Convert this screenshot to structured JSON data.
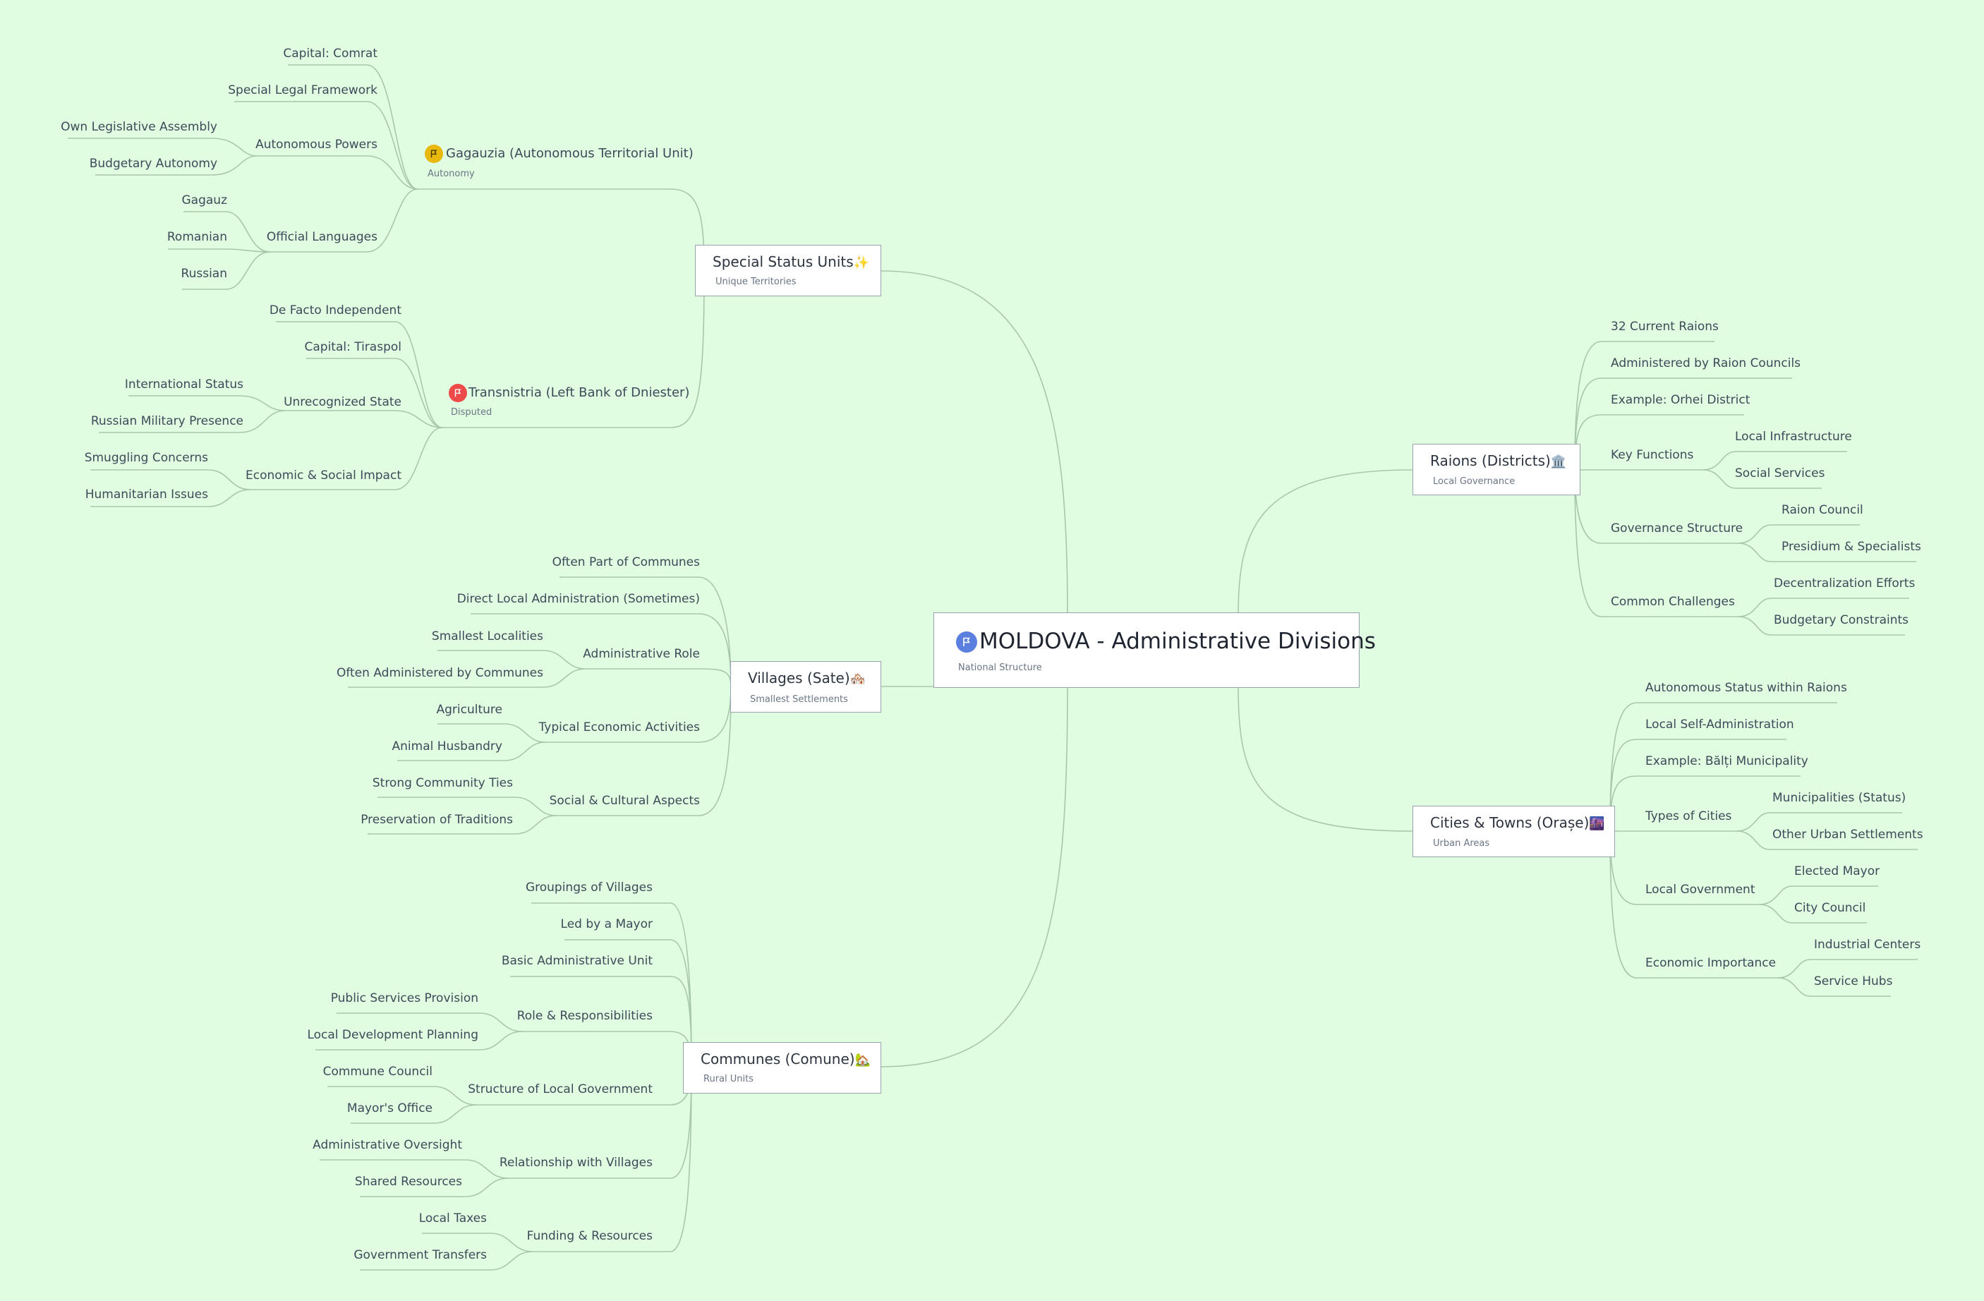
{
  "root": {
    "title": "MOLDOVA - Administrative Divisions",
    "subtitle": "National Structure"
  },
  "branches": {
    "special": {
      "title": "Special Status Units",
      "emoji": "✨",
      "subtitle": "Unique Territories",
      "gagauzia": {
        "title": "Gagauzia (Autonomous Territorial Unit)",
        "subtitle": "Autonomy",
        "capital": "Capital: Comrat",
        "legal": "Special Legal Framework",
        "powers": {
          "label": "Autonomous Powers",
          "items": [
            "Own Legislative Assembly",
            "Budgetary Autonomy"
          ]
        },
        "languages": {
          "label": "Official Languages",
          "items": [
            "Gagauz",
            "Romanian",
            "Russian"
          ]
        }
      },
      "transnistria": {
        "title": "Transnistria (Left Bank of Dniester)",
        "subtitle": "Disputed",
        "independent": "De Facto Independent",
        "capital": "Capital: Tiraspol",
        "unrecognized": {
          "label": "Unrecognized State",
          "items": [
            "International Status",
            "Russian Military Presence"
          ]
        },
        "impact": {
          "label": "Economic & Social Impact",
          "items": [
            "Smuggling Concerns",
            "Humanitarian Issues"
          ]
        }
      }
    },
    "villages": {
      "title": "Villages (Sate)",
      "emoji": "🏘️",
      "subtitle": "Smallest Settlements",
      "part": "Often Part of Communes",
      "direct": "Direct Local Administration (Sometimes)",
      "role": {
        "label": "Administrative Role",
        "items": [
          "Smallest Localities",
          "Often Administered by Communes"
        ]
      },
      "econ": {
        "label": "Typical Economic Activities",
        "items": [
          "Agriculture",
          "Animal Husbandry"
        ]
      },
      "social": {
        "label": "Social & Cultural Aspects",
        "items": [
          "Strong Community Ties",
          "Preservation of Traditions"
        ]
      }
    },
    "communes": {
      "title": "Communes (Comune)",
      "emoji": "🏡",
      "subtitle": "Rural Units",
      "groupings": "Groupings of Villages",
      "mayor": "Led by a Mayor",
      "basic": "Basic Administrative Unit",
      "role": {
        "label": "Role & Responsibilities",
        "items": [
          "Public Services Provision",
          "Local Development Planning"
        ]
      },
      "structure": {
        "label": "Structure of Local Government",
        "items": [
          "Commune Council",
          "Mayor's Office"
        ]
      },
      "relationship": {
        "label": "Relationship with Villages",
        "items": [
          "Administrative Oversight",
          "Shared Resources"
        ]
      },
      "funding": {
        "label": "Funding & Resources",
        "items": [
          "Local Taxes",
          "Government Transfers"
        ]
      }
    },
    "raions": {
      "title": "Raions (Districts)",
      "emoji": "🏛️",
      "subtitle": "Local Governance",
      "current": "32 Current Raions",
      "administered": "Administered by Raion Councils",
      "example": "Example: Orhei District",
      "functions": {
        "label": "Key Functions",
        "items": [
          "Local Infrastructure",
          "Social Services"
        ]
      },
      "governance": {
        "label": "Governance Structure",
        "items": [
          "Raion Council",
          "Presidium & Specialists"
        ]
      },
      "challenges": {
        "label": "Common Challenges",
        "items": [
          "Decentralization Efforts",
          "Budgetary Constraints"
        ]
      }
    },
    "cities": {
      "title": "Cities & Towns (Orașe)",
      "emoji": "🌆",
      "subtitle": "Urban Areas",
      "autonomous": "Autonomous Status within Raions",
      "self": "Local Self-Administration",
      "example": "Example: Bălți Municipality",
      "types": {
        "label": "Types of Cities",
        "items": [
          "Municipalities (Status)",
          "Other Urban Settlements"
        ]
      },
      "government": {
        "label": "Local Government",
        "items": [
          "Elected Mayor",
          "City Council"
        ]
      },
      "economic": {
        "label": "Economic Importance",
        "items": [
          "Industrial Centers",
          "Service Hubs"
        ]
      }
    }
  },
  "icons": {
    "root": "flag-icon",
    "gagauzia": "flag-icon",
    "transnistria": "flag-icon"
  },
  "colors": {
    "background": "#e0fde1",
    "line": "#a7c7ad",
    "root_flag": "#5b7fde",
    "gagauzia_flag": "#e8b80c",
    "transnistria_flag": "#ee4a4a"
  }
}
